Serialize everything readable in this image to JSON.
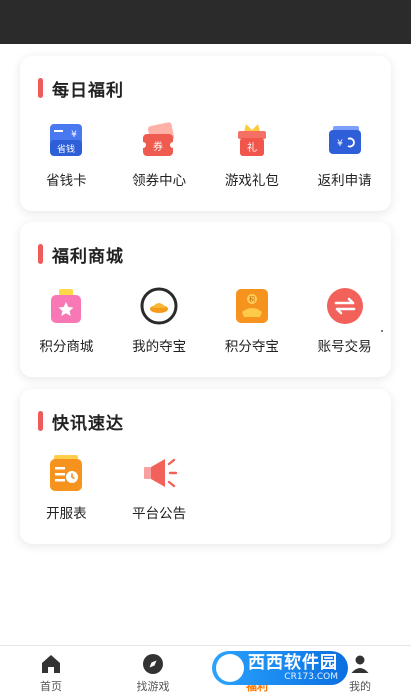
{
  "sections": [
    {
      "title": "每日福利",
      "items": [
        {
          "label": "省钱卡",
          "icon": "savings-card-icon",
          "badge": "省钱"
        },
        {
          "label": "领券中心",
          "icon": "coupon-center-icon",
          "badge": "券"
        },
        {
          "label": "游戏礼包",
          "icon": "gift-pack-icon",
          "badge": "礼"
        },
        {
          "label": "返利申请",
          "icon": "rebate-wallet-icon"
        }
      ]
    },
    {
      "title": "福利商城",
      "items": [
        {
          "label": "积分商城",
          "icon": "points-mall-bag-icon"
        },
        {
          "label": "我的夺宝",
          "icon": "my-treasure-icon"
        },
        {
          "label": "积分夺宝",
          "icon": "points-treasure-icon",
          "badge": "积"
        },
        {
          "label": "账号交易",
          "icon": "account-trade-icon"
        }
      ]
    },
    {
      "title": "快讯速达",
      "items": [
        {
          "label": "开服表",
          "icon": "server-schedule-icon"
        },
        {
          "label": "平台公告",
          "icon": "announcement-megaphone-icon"
        }
      ]
    }
  ],
  "tabbar": [
    {
      "label": "首页",
      "icon": "home-icon",
      "active": false
    },
    {
      "label": "找游戏",
      "icon": "compass-icon",
      "active": false
    },
    {
      "label": "福利",
      "icon": "gift-icon",
      "active": true
    },
    {
      "label": "我的",
      "icon": "user-icon",
      "active": false
    }
  ],
  "watermark": {
    "main": "西西软件园",
    "sub": "CR173.COM"
  },
  "colors": {
    "accent": "#ef5a5a",
    "active_tab": "#ff7a00",
    "status_bar": "#2b2b2b"
  }
}
